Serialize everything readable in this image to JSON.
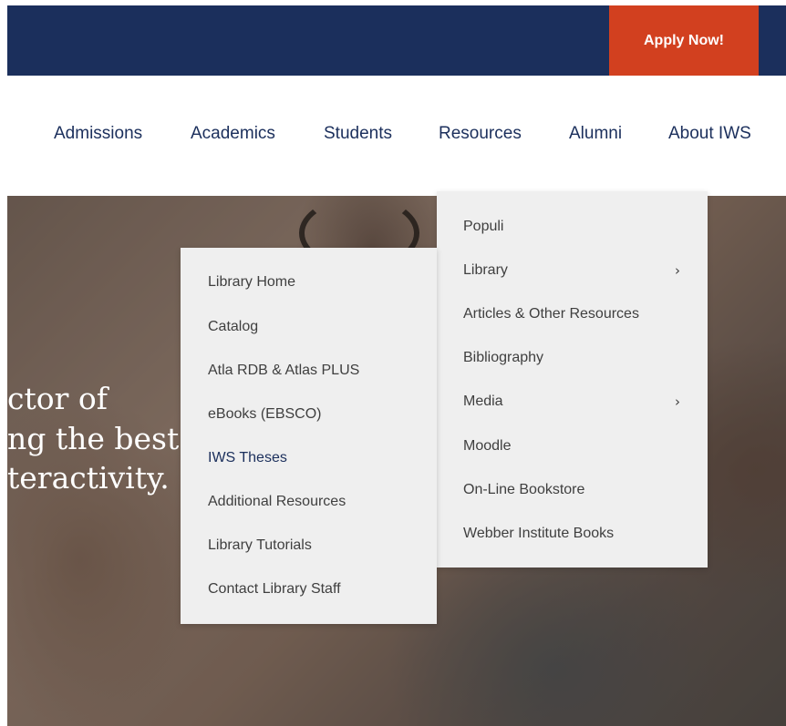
{
  "header": {
    "apply_label": "Apply Now!"
  },
  "nav": {
    "items": [
      "Admissions",
      "Academics",
      "Students",
      "Resources",
      "Alumni",
      "About IWS"
    ]
  },
  "hero": {
    "lines": [
      "ctor of",
      "ng the best",
      "teractivity."
    ]
  },
  "resources_menu": {
    "items": [
      {
        "label": "Populi"
      },
      {
        "label": "Library",
        "has_submenu": true,
        "icon": "chevron-right-icon"
      },
      {
        "label": "Articles & Other Resources"
      },
      {
        "label": "Bibliography"
      },
      {
        "label": "Media",
        "has_submenu": true,
        "icon": "chevron-right-icon"
      },
      {
        "label": "Moodle"
      },
      {
        "label": "On-Line Bookstore"
      },
      {
        "label": "Webber Institute Books"
      }
    ],
    "chevron_glyph": "›"
  },
  "library_submenu": {
    "items": [
      {
        "label": "Library Home"
      },
      {
        "label": "Catalog"
      },
      {
        "label": "Atla RDB & Atlas PLUS"
      },
      {
        "label": "eBooks (EBSCO)"
      },
      {
        "label": "IWS Theses",
        "active": true
      },
      {
        "label": "Additional Resources"
      },
      {
        "label": "Library Tutorials"
      },
      {
        "label": "Contact Library Staff"
      }
    ]
  },
  "colors": {
    "navy": "#1b2f5c",
    "accent": "#d2401f",
    "menu_bg": "#efefef",
    "menu_text": "#3f3f3f"
  }
}
